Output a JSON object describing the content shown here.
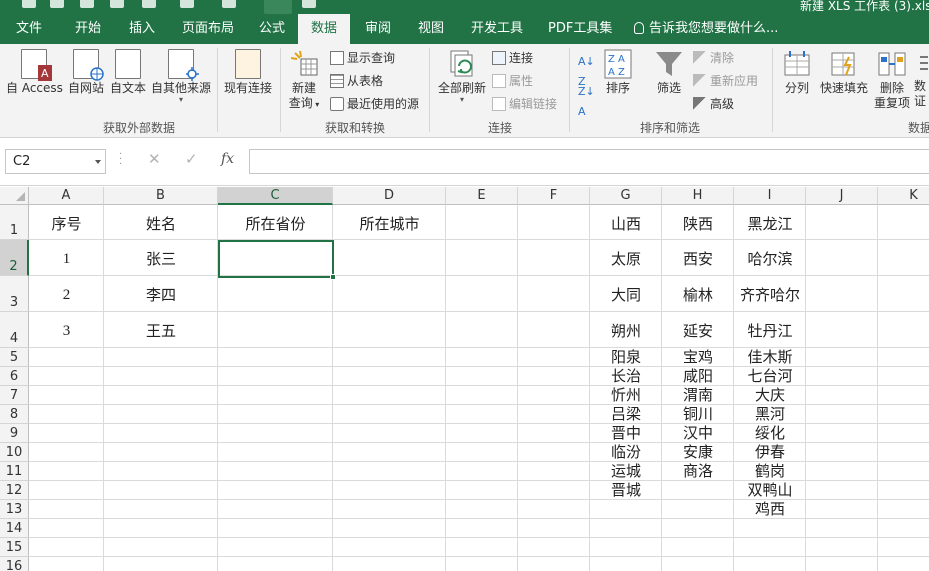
{
  "titlebar": {
    "doc_title": "新建 XLS 工作表 (3).xls"
  },
  "tabs": [
    "文件",
    "开始",
    "插入",
    "页面布局",
    "公式",
    "数据",
    "审阅",
    "视图",
    "开发工具",
    "PDF工具集"
  ],
  "active_tab": "数据",
  "tellme": "告诉我您想要做什么...",
  "ribbon": {
    "get_external": {
      "buttons": [
        "自 Access",
        "自网站",
        "自文本",
        "自其他来源",
        "现有连接"
      ],
      "label": "获取外部数据"
    },
    "get_transform": {
      "new_query": [
        "新建",
        "查询"
      ],
      "small": [
        "显示查询",
        "从表格",
        "最近使用的源"
      ],
      "label": "获取和转换"
    },
    "connections": {
      "refresh_all": "全部刷新",
      "small": [
        "连接",
        "属性",
        "编辑链接"
      ],
      "label": "连接"
    },
    "sort_filter": {
      "sort": "排序",
      "filter": "筛选",
      "small": [
        "清除",
        "重新应用",
        "高级"
      ],
      "label": "排序和筛选"
    },
    "data_tools": {
      "buttons": [
        "分列",
        "快速填充"
      ],
      "remove_dup": [
        "删除",
        "重复项"
      ],
      "partial": [
        "数",
        "证"
      ],
      "label": "数据"
    }
  },
  "formula_bar": {
    "name_box": "C2",
    "cancel": "✕",
    "enter": "✓",
    "fx": "fx",
    "formula": ""
  },
  "sheet": {
    "columns": [
      "A",
      "B",
      "C",
      "D",
      "E",
      "F",
      "G",
      "H",
      "I",
      "J",
      "K"
    ],
    "selected_cell": "C2",
    "headers": [
      "序号",
      "姓名",
      "所在省份",
      "所在城市"
    ],
    "rows": [
      {
        "no": "1",
        "name": "张三"
      },
      {
        "no": "2",
        "name": "李四"
      },
      {
        "no": "3",
        "name": "王五"
      }
    ],
    "provinces": [
      {
        "name": "山西",
        "cities": [
          "太原",
          "大同",
          "朔州",
          "阳泉",
          "长治",
          "忻州",
          "吕梁",
          "晋中",
          "临汾",
          "运城",
          "晋城"
        ]
      },
      {
        "name": "陕西",
        "cities": [
          "西安",
          "榆林",
          "延安",
          "宝鸡",
          "咸阳",
          "渭南",
          "铜川",
          "汉中",
          "安康",
          "商洛"
        ]
      },
      {
        "name": "黑龙江",
        "cities": [
          "哈尔滨",
          "齐齐哈尔",
          "牡丹江",
          "佳木斯",
          "七台河",
          "大庆",
          "黑河",
          "绥化",
          "伊春",
          "鹤岗",
          "双鸭山",
          "鸡西"
        ]
      }
    ]
  },
  "colors": {
    "excel_green": "#217346",
    "ribbon_bg": "#f3f3f3",
    "header_bg": "#f3f3f3",
    "gridline": "#dadada"
  }
}
